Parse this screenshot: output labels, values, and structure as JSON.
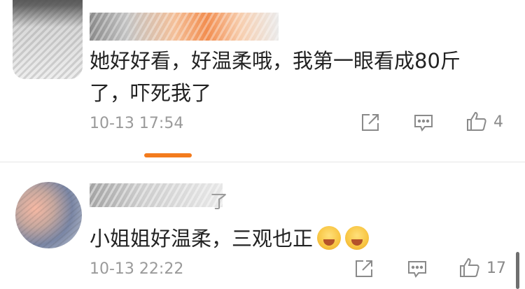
{
  "comments": [
    {
      "username": "",
      "text_line1": "她好好看，好温柔哦，我第一眼看成80斤",
      "text_line2": "了，吓死我了",
      "timestamp": "10-13 17:54",
      "like_count": "4"
    },
    {
      "username_tail": "了",
      "text": "小姐姐好温柔，三观也正",
      "timestamp": "10-13 22:22",
      "like_count": "17"
    }
  ],
  "icons": {
    "share": "share-icon",
    "reply": "comment-icon",
    "like": "thumbs-up-icon",
    "emoji": "smiling-face-emoji"
  },
  "colors": {
    "accent": "#f37b1d",
    "text": "#222222",
    "meta": "#9a9a9a"
  }
}
